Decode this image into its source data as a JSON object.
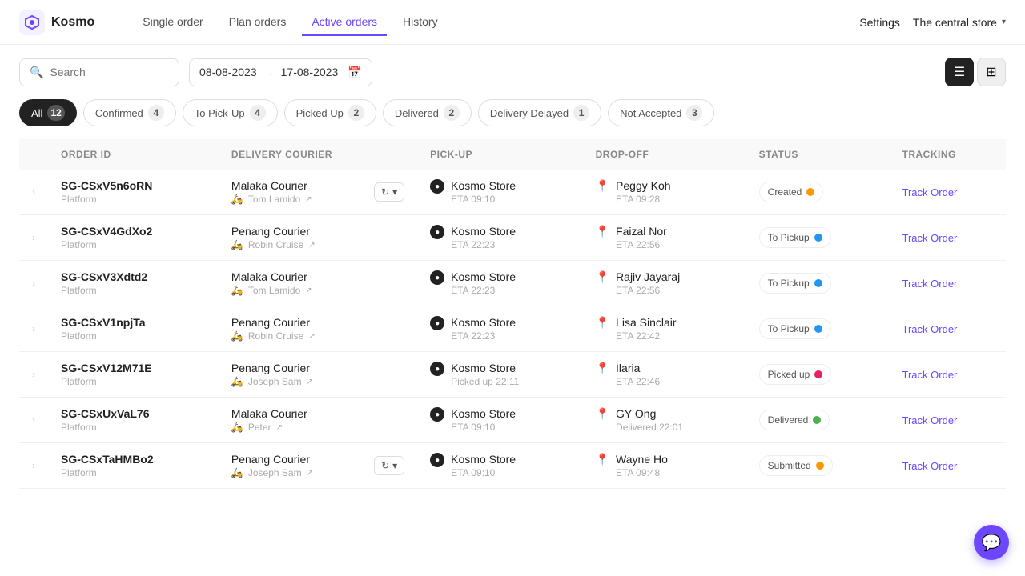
{
  "nav": {
    "logo_text": "Kosmo",
    "links": [
      {
        "label": "Single order",
        "active": false
      },
      {
        "label": "Plan orders",
        "active": false
      },
      {
        "label": "Active orders",
        "active": true
      },
      {
        "label": "History",
        "active": false
      }
    ],
    "settings_label": "Settings",
    "store_name": "The central store"
  },
  "toolbar": {
    "search_placeholder": "Search",
    "date_start": "08-08-2023",
    "date_end": "17-08-2023"
  },
  "filters": [
    {
      "label": "All",
      "count": "12",
      "active": true,
      "count_style": "normal"
    },
    {
      "label": "Confirmed",
      "count": "4",
      "active": false,
      "count_style": "normal"
    },
    {
      "label": "To Pick-Up",
      "count": "4",
      "active": false,
      "count_style": "normal"
    },
    {
      "label": "Picked Up",
      "count": "2",
      "active": false,
      "count_style": "normal"
    },
    {
      "label": "Delivered",
      "count": "2",
      "active": false,
      "count_style": "normal"
    },
    {
      "label": "Delivery Delayed",
      "count": "1",
      "active": false,
      "count_style": "orange"
    },
    {
      "label": "Not Accepted",
      "count": "3",
      "active": false,
      "count_style": "red"
    }
  ],
  "table": {
    "headers": [
      "",
      "ORDER ID",
      "DELIVERY COURIER",
      "PICK-UP",
      "DROP-OFF",
      "STATUS",
      "TRACKING"
    ],
    "rows": [
      {
        "order_id": "SG-CSxV5n6oRN",
        "order_sub": "Platform",
        "courier_company": "Malaka Courier",
        "courier_name": "Tom Lamido",
        "has_action": true,
        "pickup_name": "Kosmo Store",
        "pickup_eta": "ETA 09:10",
        "dropoff_name": "Peggy Koh",
        "dropoff_eta": "ETA 09:28",
        "status": "Created",
        "status_dot": "orange",
        "track_label": "Track Order"
      },
      {
        "order_id": "SG-CSxV4GdXo2",
        "order_sub": "Platform",
        "courier_company": "Penang Courier",
        "courier_name": "Robin Cruise",
        "has_action": false,
        "pickup_name": "Kosmo Store",
        "pickup_eta": "ETA 22:23",
        "dropoff_name": "Faizal Nor",
        "dropoff_eta": "ETA 22:56",
        "status": "To Pickup",
        "status_dot": "blue",
        "track_label": "Track Order"
      },
      {
        "order_id": "SG-CSxV3Xdtd2",
        "order_sub": "Platform",
        "courier_company": "Malaka Courier",
        "courier_name": "Tom Lamido",
        "has_action": false,
        "pickup_name": "Kosmo Store",
        "pickup_eta": "ETA 22:23",
        "dropoff_name": "Rajiv Jayaraj",
        "dropoff_eta": "ETA 22:56",
        "status": "To Pickup",
        "status_dot": "blue",
        "track_label": "Track Order"
      },
      {
        "order_id": "SG-CSxV1npjTa",
        "order_sub": "Platform",
        "courier_company": "Penang Courier",
        "courier_name": "Robin Cruise",
        "has_action": false,
        "pickup_name": "Kosmo Store",
        "pickup_eta": "ETA 22:23",
        "dropoff_name": "Lisa Sinclair",
        "dropoff_eta": "ETA 22:42",
        "status": "To Pickup",
        "status_dot": "blue",
        "track_label": "Track Order"
      },
      {
        "order_id": "SG-CSxV12M71E",
        "order_sub": "Platform",
        "courier_company": "Penang Courier",
        "courier_name": "Joseph Sam",
        "has_action": false,
        "pickup_name": "Kosmo Store",
        "pickup_eta": "Picked up 22:11",
        "dropoff_name": "Ilaria",
        "dropoff_eta": "ETA 22:46",
        "status": "Picked up",
        "status_dot": "pink",
        "track_label": "Track Order"
      },
      {
        "order_id": "SG-CSxUxVaL76",
        "order_sub": "Platform",
        "courier_company": "Malaka Courier",
        "courier_name": "Peter",
        "has_action": false,
        "pickup_name": "Kosmo Store",
        "pickup_eta": "ETA 09:10",
        "dropoff_name": "GY Ong",
        "dropoff_eta": "Delivered 22:01",
        "status": "Delivered",
        "status_dot": "green",
        "track_label": "Track Order"
      },
      {
        "order_id": "SG-CSxTaHMBo2",
        "order_sub": "Platform",
        "courier_company": "Penang Courier",
        "courier_name": "Joseph Sam",
        "has_action": true,
        "pickup_name": "Kosmo Store",
        "pickup_eta": "ETA 09:10",
        "dropoff_name": "Wayne Ho",
        "dropoff_eta": "ETA 09:48",
        "status": "Submitted",
        "status_dot": "orange",
        "track_label": "Track Order"
      }
    ]
  }
}
